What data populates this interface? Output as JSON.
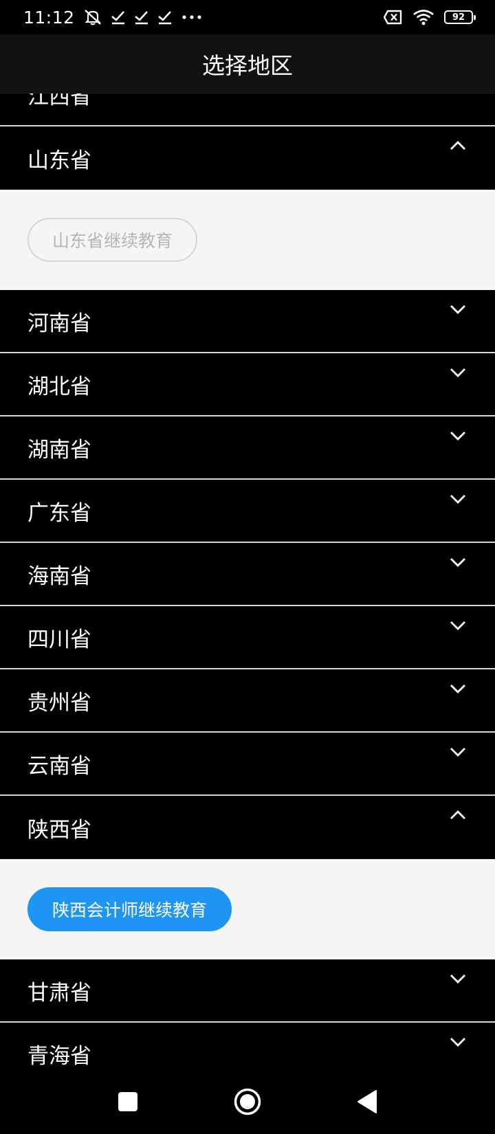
{
  "status_bar": {
    "time": "11:12",
    "battery": "92",
    "icons": [
      "mute-icon",
      "check-icon",
      "check-icon",
      "check-icon",
      "more-dots-icon",
      "sim-off-icon",
      "wifi-icon",
      "battery-icon"
    ]
  },
  "header": {
    "title": "选择地区"
  },
  "provinces": [
    {
      "label": "江西省",
      "expanded": false
    },
    {
      "label": "山东省",
      "expanded": true,
      "option": {
        "label": "山东省继续教育",
        "selected": false
      }
    },
    {
      "label": "河南省",
      "expanded": false
    },
    {
      "label": "湖北省",
      "expanded": false
    },
    {
      "label": "湖南省",
      "expanded": false
    },
    {
      "label": "广东省",
      "expanded": false
    },
    {
      "label": "海南省",
      "expanded": false
    },
    {
      "label": "四川省",
      "expanded": false
    },
    {
      "label": "贵州省",
      "expanded": false
    },
    {
      "label": "云南省",
      "expanded": false
    },
    {
      "label": "陕西省",
      "expanded": true,
      "option": {
        "label": "陕西会计师继续教育",
        "selected": true
      }
    },
    {
      "label": "甘肃省",
      "expanded": false
    },
    {
      "label": "青海省",
      "expanded": false
    }
  ],
  "colors": {
    "accent": "#1e95f5",
    "panel_bg": "#f5f5f5",
    "row_bg": "#000000",
    "divider": "#d9d9d9",
    "inactive_text": "#b5b5b5"
  },
  "nav_bar": {
    "icons": [
      "recent-apps-icon",
      "home-icon",
      "back-icon"
    ]
  }
}
